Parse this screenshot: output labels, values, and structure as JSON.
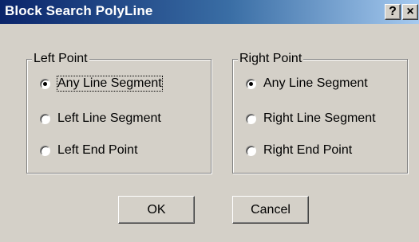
{
  "window": {
    "title": "Block Search PolyLine",
    "help_label": "?",
    "close_label": "×"
  },
  "left_group": {
    "label": "Left Point",
    "options": [
      {
        "label": "Any Line Segment",
        "checked": true
      },
      {
        "label": "Left Line Segment",
        "checked": false
      },
      {
        "label": "Left End Point",
        "checked": false
      }
    ]
  },
  "right_group": {
    "label": "Right Point",
    "options": [
      {
        "label": "Any Line Segment",
        "checked": true
      },
      {
        "label": "Right Line Segment",
        "checked": false
      },
      {
        "label": "Right End Point",
        "checked": false
      }
    ]
  },
  "buttons": {
    "ok_label": "OK",
    "cancel_label": "Cancel"
  }
}
